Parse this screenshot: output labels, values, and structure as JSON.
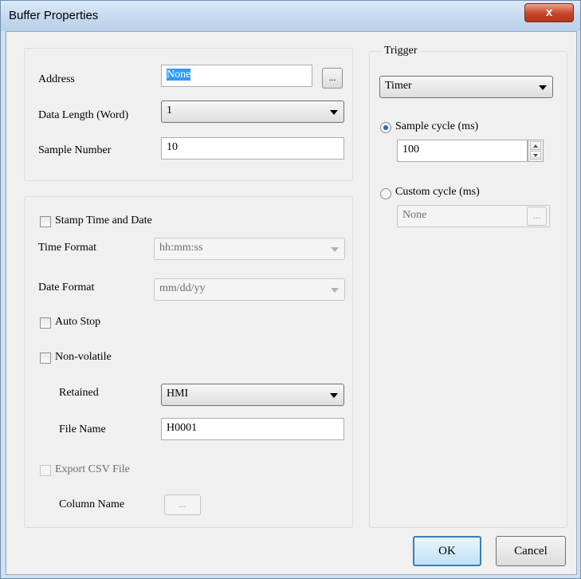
{
  "window": {
    "title": "Buffer Properties",
    "close_glyph": "x"
  },
  "address": {
    "label": "Address",
    "value": "None",
    "browse_label": "..."
  },
  "data_length": {
    "label": "Data Length (Word)",
    "value": "1"
  },
  "sample_number": {
    "label": "Sample Number",
    "value": "10"
  },
  "stamp": {
    "label": "Stamp Time and Date",
    "checked": false
  },
  "time_format": {
    "label": "Time Format",
    "value": "hh:mm:ss"
  },
  "date_format": {
    "label": "Date Format",
    "value": "mm/dd/yy"
  },
  "auto_stop": {
    "label": "Auto Stop",
    "checked": false
  },
  "non_volatile": {
    "label": "Non-volatile",
    "checked": false
  },
  "retained": {
    "label": "Retained",
    "value": "HMI"
  },
  "file_name": {
    "label": "File Name",
    "value": "H0001"
  },
  "export_csv": {
    "label": "Export CSV File",
    "checked": false
  },
  "column_name": {
    "label": "Column Name",
    "browse_label": "..."
  },
  "trigger": {
    "title": "Trigger",
    "mode": "Timer",
    "sample_cycle_label": "Sample cycle (ms)",
    "sample_cycle_value": "100",
    "custom_cycle_label": "Custom cycle (ms)",
    "custom_cycle_value": "None",
    "custom_browse_label": "..."
  },
  "buttons": {
    "ok": "OK",
    "cancel": "Cancel"
  }
}
